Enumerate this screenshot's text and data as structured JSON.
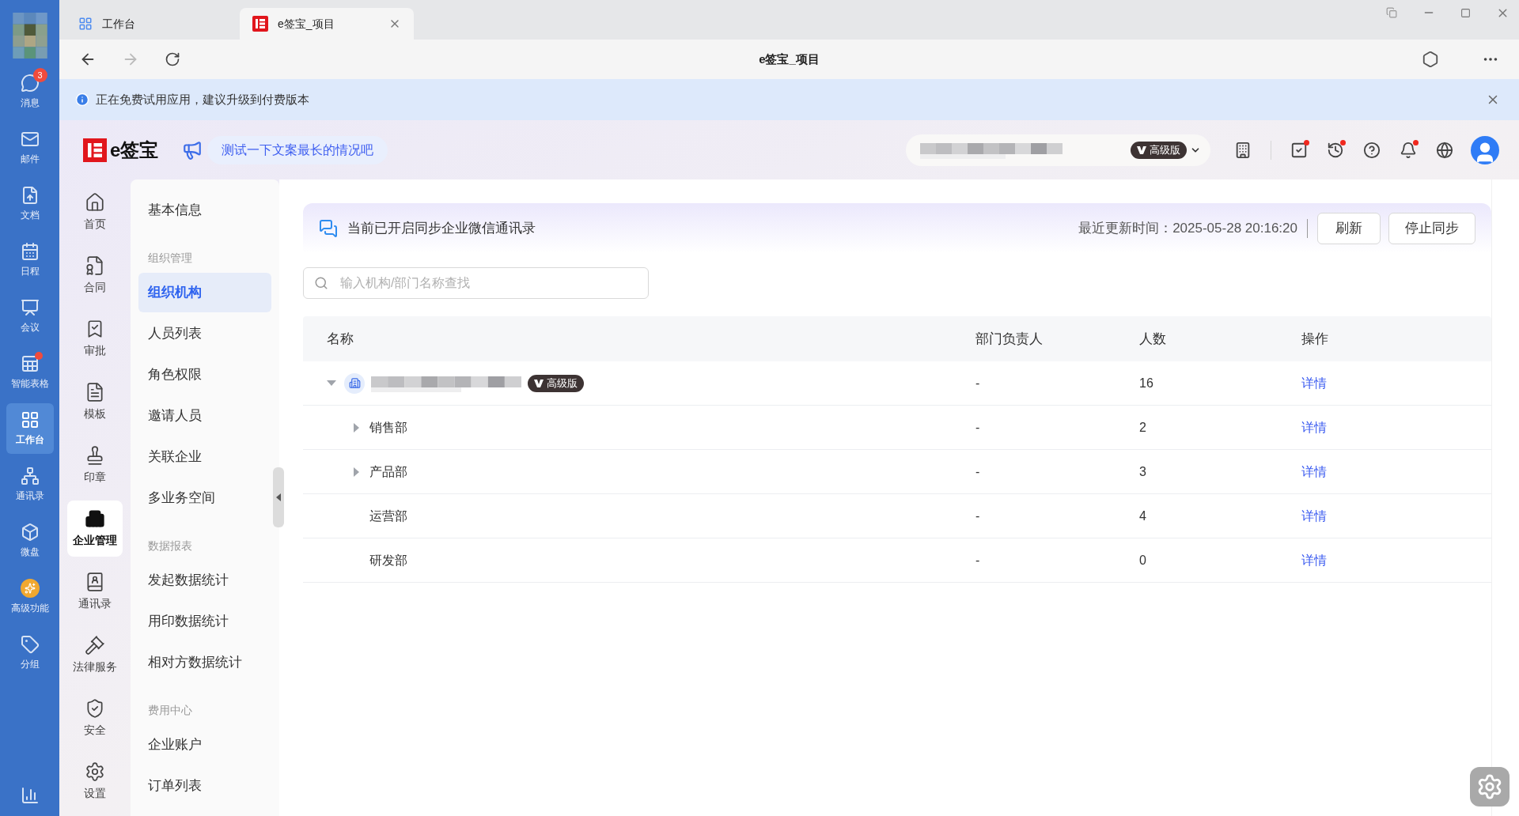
{
  "rail": {
    "items": [
      {
        "label": "消息",
        "selected": false,
        "badge": "3",
        "dot": false
      },
      {
        "label": "邮件",
        "selected": false,
        "dot": false
      },
      {
        "label": "文档",
        "selected": false,
        "dot": false
      },
      {
        "label": "日程",
        "selected": false,
        "dot": false
      },
      {
        "label": "会议",
        "selected": false,
        "dot": false
      },
      {
        "label": "智能表格",
        "selected": false,
        "dot": true
      },
      {
        "label": "工作台",
        "selected": true,
        "dot": false
      },
      {
        "label": "通讯录",
        "selected": false,
        "dot": false
      },
      {
        "label": "微盘",
        "selected": false,
        "dot": false
      },
      {
        "label": "高级功能",
        "selected": false,
        "dot": false
      },
      {
        "label": "分组",
        "selected": false,
        "dot": false
      }
    ]
  },
  "tabs": [
    {
      "label": "工作台",
      "selected": false
    },
    {
      "label": "e签宝_项目",
      "selected": true
    }
  ],
  "nav": {
    "title": "e签宝_项目"
  },
  "banner": {
    "text": "正在免费试用应用，建议升级到付费版本"
  },
  "header": {
    "logo_text": "e签宝",
    "announcement": "测试一下文案最长的情况吧",
    "plan_badge": "高级版",
    "tools": [
      {
        "dot": false
      },
      {
        "dot": true
      },
      {
        "dot": true
      },
      {
        "dot": false
      },
      {
        "dot": true
      },
      {
        "dot": false
      }
    ]
  },
  "app_nav": [
    {
      "label": "首页",
      "selected": false
    },
    {
      "label": "合同",
      "selected": false
    },
    {
      "label": "审批",
      "selected": false
    },
    {
      "label": "模板",
      "selected": false
    },
    {
      "label": "印章",
      "selected": false
    },
    {
      "label": "企业管理",
      "selected": true
    },
    {
      "label": "通讯录",
      "selected": false
    },
    {
      "label": "法律服务",
      "selected": false
    },
    {
      "label": "安全",
      "selected": false
    },
    {
      "label": "设置",
      "selected": false
    }
  ],
  "menu": [
    {
      "kind": "item",
      "label": "基本信息",
      "selected": false
    },
    {
      "kind": "group",
      "label": "组织管理"
    },
    {
      "kind": "item",
      "label": "组织机构",
      "selected": true
    },
    {
      "kind": "item",
      "label": "人员列表",
      "selected": false
    },
    {
      "kind": "item",
      "label": "角色权限",
      "selected": false
    },
    {
      "kind": "item",
      "label": "邀请人员",
      "selected": false
    },
    {
      "kind": "item",
      "label": "关联企业",
      "selected": false
    },
    {
      "kind": "item",
      "label": "多业务空间",
      "selected": false
    },
    {
      "kind": "group",
      "label": "数据报表"
    },
    {
      "kind": "item",
      "label": "发起数据统计",
      "selected": false
    },
    {
      "kind": "item",
      "label": "用印数据统计",
      "selected": false
    },
    {
      "kind": "item",
      "label": "相对方数据统计",
      "selected": false
    },
    {
      "kind": "group",
      "label": "费用中心"
    },
    {
      "kind": "item",
      "label": "企业账户",
      "selected": false
    },
    {
      "kind": "item",
      "label": "订单列表",
      "selected": false
    }
  ],
  "sync": {
    "text": "当前已开启同步企业微信通讯录",
    "updated": "最近更新时间：2025-05-28 20:16:20",
    "buttons": [
      "刷新",
      "停止同步"
    ]
  },
  "search": {
    "placeholder": "输入机构/部门名称查找"
  },
  "table": {
    "columns": [
      "名称",
      "部门负责人",
      "人数",
      "操作"
    ],
    "rows": [
      {
        "kind": "root",
        "expanded": true,
        "badge": "高级版",
        "head": "-",
        "count": "16",
        "action": "详情",
        "children": [
          {
            "kind": "branch",
            "name": "销售部",
            "expanded": false,
            "head": "-",
            "count": "2",
            "action": "详情"
          },
          {
            "kind": "branch",
            "name": "产品部",
            "expanded": false,
            "head": "-",
            "count": "3",
            "action": "详情"
          },
          {
            "kind": "leaf",
            "name": "运营部",
            "head": "-",
            "count": "4",
            "action": "详情"
          },
          {
            "kind": "leaf",
            "name": "研发部",
            "head": "-",
            "count": "0",
            "action": "详情"
          }
        ]
      }
    ]
  }
}
